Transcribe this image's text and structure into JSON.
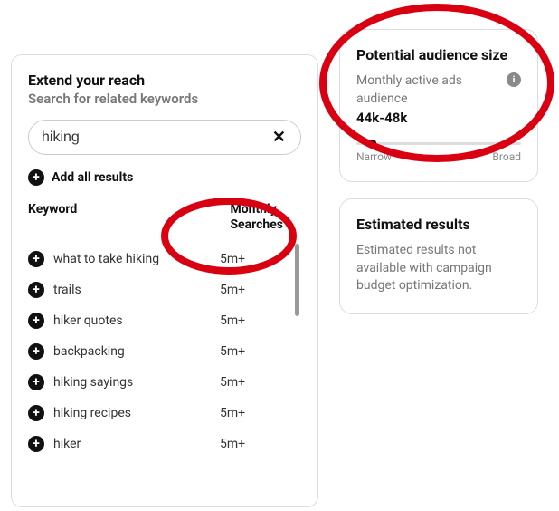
{
  "left": {
    "title": "Extend your reach",
    "subtitle": "Search for related keywords",
    "search_value": "hiking",
    "add_all_label": "Add all results",
    "header_keyword": "Keyword",
    "header_monthly_l1": "Monthly",
    "header_monthly_l2": "Searches",
    "rows": [
      {
        "name": "what to take hiking",
        "value": "5m+"
      },
      {
        "name": "trails",
        "value": "5m+"
      },
      {
        "name": "hiker quotes",
        "value": "5m+"
      },
      {
        "name": "backpacking",
        "value": "5m+"
      },
      {
        "name": "hiking sayings",
        "value": "5m+"
      },
      {
        "name": "hiking recipes",
        "value": "5m+"
      },
      {
        "name": "hiker",
        "value": "5m+"
      }
    ]
  },
  "audience": {
    "title": "Potential audience size",
    "sub": "Monthly active ads audience",
    "value": "44k-48k",
    "narrow": "Narrow",
    "broad": "Broad"
  },
  "est": {
    "title": "Estimated results",
    "body": "Estimated results not available with campaign budget optimization."
  }
}
